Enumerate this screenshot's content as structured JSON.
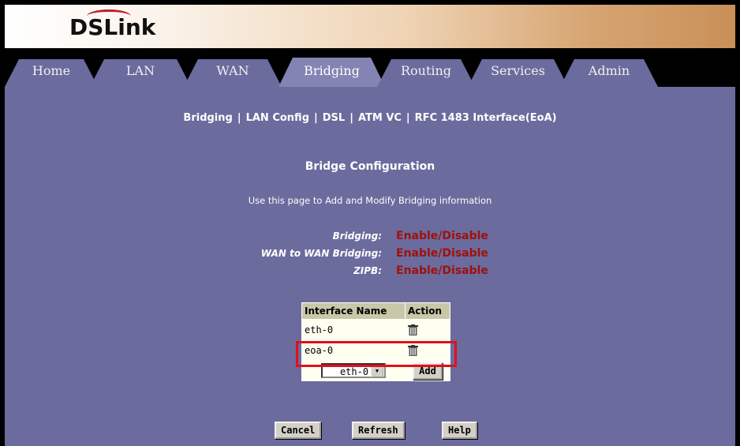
{
  "brand": {
    "logo_text": "DSLink"
  },
  "tabs": [
    {
      "label": "Home",
      "active": false
    },
    {
      "label": "LAN",
      "active": false
    },
    {
      "label": "WAN",
      "active": false
    },
    {
      "label": "Bridging",
      "active": true
    },
    {
      "label": "Routing",
      "active": false
    },
    {
      "label": "Services",
      "active": false
    },
    {
      "label": "Admin",
      "active": false
    }
  ],
  "subnav": [
    "Bridging",
    "LAN Config",
    "DSL",
    "ATM VC",
    "RFC 1483 Interface(EoA)"
  ],
  "page": {
    "title": "Bridge Configuration",
    "description": "Use this page to Add and Modify Bridging information"
  },
  "settings": [
    {
      "label": "Bridging:",
      "value": "Enable/Disable"
    },
    {
      "label": "WAN to WAN Bridging:",
      "value": "Enable/Disable"
    },
    {
      "label": "ZIPB:",
      "value": "Enable/Disable"
    }
  ],
  "table": {
    "headers": [
      "Interface Name",
      "Action"
    ],
    "rows": [
      {
        "interface": "eth-0",
        "action_icon": "trash-icon"
      },
      {
        "interface": "eoa-0",
        "action_icon": "trash-icon"
      }
    ],
    "add_select_value": "eth-0",
    "add_button_label": "Add"
  },
  "buttons": {
    "cancel": "Cancel",
    "refresh": "Refresh",
    "help": "Help"
  },
  "colors": {
    "page_background": "#6b6b9e",
    "enable_disable_text": "#a0100c",
    "highlight_box": "#e0101c"
  }
}
